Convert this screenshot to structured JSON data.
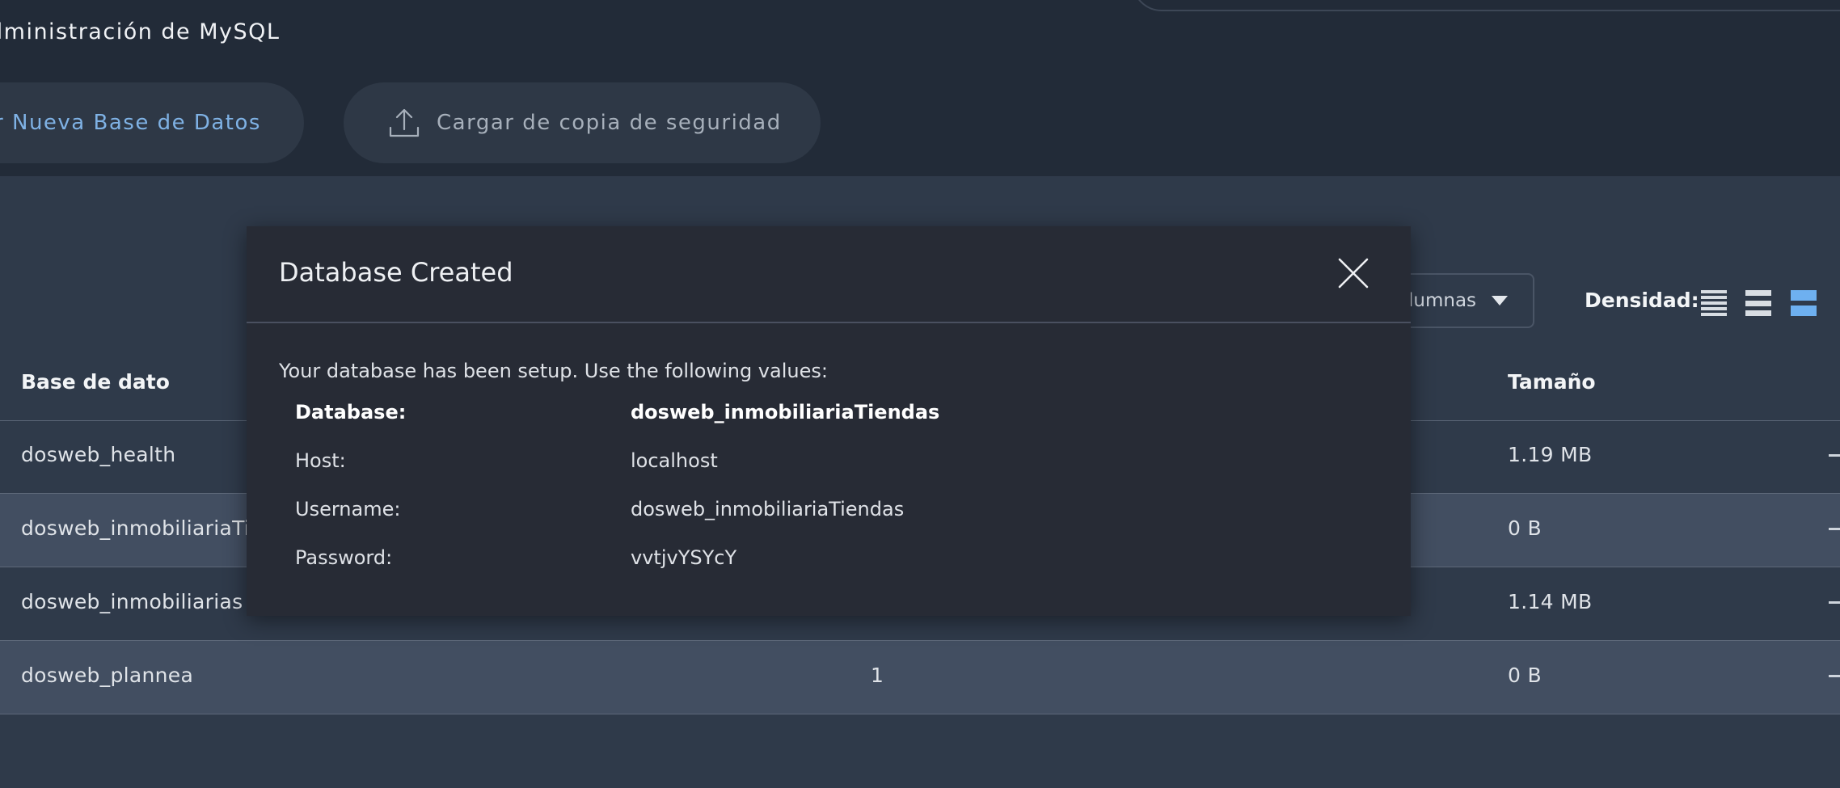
{
  "header": {
    "title": "dministración de MySQL",
    "new_db_button": "r Nueva Base de Datos",
    "upload_button": "Cargar de copia de seguridad"
  },
  "toolbar": {
    "columns_button": "lumnas",
    "density_label": "Densidad:",
    "density_options": [
      "compact-icon",
      "standard-icon",
      "comfortable-icon"
    ],
    "density_selected": 2,
    "accent": "#6eb0f0"
  },
  "table": {
    "headers": [
      "Base de dato",
      "Tamaño"
    ],
    "rows": [
      {
        "name": "dosweb_health",
        "count": "",
        "size": "1.19 MB"
      },
      {
        "name": "dosweb_inmobiliariaTie",
        "count": "",
        "size": "0 B"
      },
      {
        "name": "dosweb_inmobiliarias",
        "count": "",
        "size": "1.14 MB"
      },
      {
        "name": "dosweb_plannea",
        "count": "1",
        "size": "0 B"
      }
    ]
  },
  "modal": {
    "title": "Database Created",
    "intro": "Your database has been setup. Use the following values:",
    "fields": [
      {
        "key": "Database:",
        "value": "dosweb_inmobiliariaTiendas"
      },
      {
        "key": "Host:",
        "value": "localhost"
      },
      {
        "key": "Username:",
        "value": "dosweb_inmobiliariaTiendas"
      },
      {
        "key": "Password:",
        "value": "vvtjvYSYcY"
      }
    ]
  }
}
